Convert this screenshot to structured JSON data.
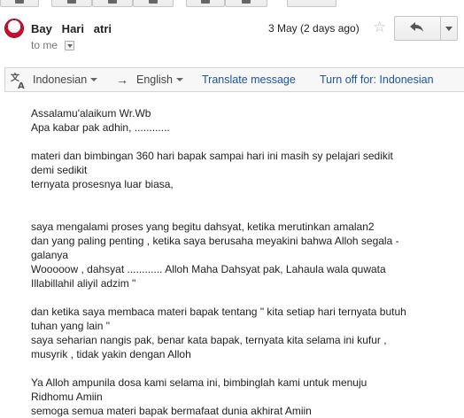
{
  "header": {
    "sender_name": "Bay   Hari   atri",
    "recipient_label": "to me",
    "date": "3 May (2 days ago)",
    "star_glyph": "☆"
  },
  "translate_bar": {
    "source_language": "Indonesian",
    "arrow": "→",
    "target_language": "English",
    "translate_link": "Translate message",
    "turn_off_link": "Turn off for: Indonesian"
  },
  "message": {
    "lines": [
      "Assalamu'alaikum Wr.Wb",
      "Apa kabar pak adhin, ............",
      "",
      "materi dan bimbingan 360 hari bapak sampai hari ini masih sy pelajari sedikit",
      "demi sedikit",
      "ternyata prosesnya luar biasa,",
      "",
      "",
      "saya mengalami proses yang begitu dahsyat, ketika merutinkan amalan2",
      "dan yang paling penting , ketika saya berusaha meyakini bahwa Alloh segala -",
      "galanya",
      "Wooooow , dahsyat ............ Alloh Maha Dahsyat pak, Lahaula wala quwata",
      "Illabillahil aliyil adzim \"",
      "",
      "dan ketika saya membaca materi bapak tentang \" kita setiap hari ternyata butuh",
      "tuhan yang lain \"",
      "saya seharian nangis pak, benar kata bapak, ternyata kita selama ini kufur ,",
      "musyrik , tidak yakin dengan Alloh",
      "",
      "Ya Alloh ampunila dosa kami selama ini, bimbinglah kami untuk menuju",
      "Ridhomu Amiin",
      "semoga semua materi bapak bermafaat dunia akhirat Amiin"
    ]
  },
  "icons": {
    "avatar": "avatar",
    "star": "star-icon",
    "reply": "reply-icon",
    "more": "chevron-down-icon",
    "translate": "translate-icon"
  },
  "colors": {
    "link": "#1a55a8",
    "bar_background": "#f7f7f7",
    "avatar_red": "#c8102e"
  }
}
